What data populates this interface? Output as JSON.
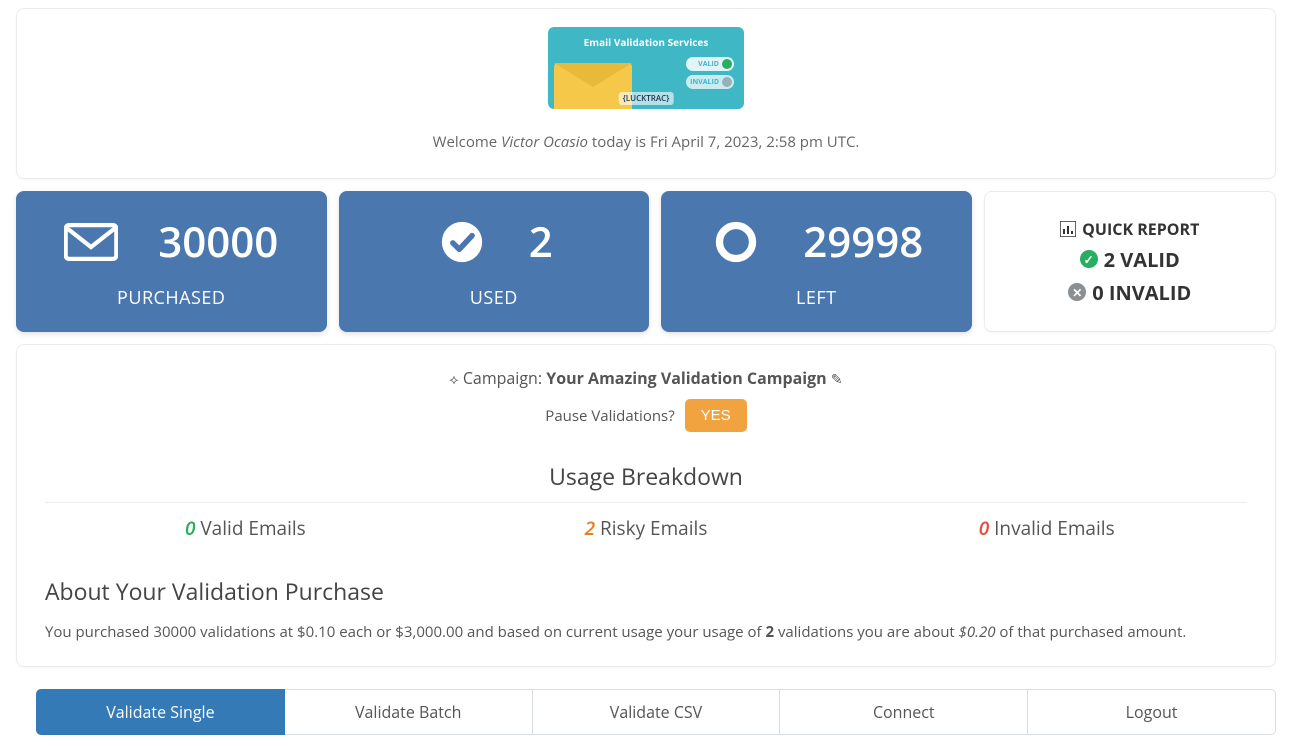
{
  "banner": {
    "title": "Email Validation Services",
    "pill_valid": "VALID",
    "pill_invalid": "INVALID",
    "brand": "{LUCKTRAC}"
  },
  "welcome": {
    "prefix": "Welcome ",
    "user_name": "Victor Ocasio",
    "middle": " today is ",
    "datetime": "Fri April 7, 2023, 2:58 pm UTC."
  },
  "stats": {
    "purchased": {
      "value": "30000",
      "label": "PURCHASED"
    },
    "used": {
      "value": "2",
      "label": "USED"
    },
    "left": {
      "value": "29998",
      "label": "LEFT"
    }
  },
  "quick_report": {
    "title": "QUICK REPORT",
    "valid_line": "2 VALID",
    "invalid_line": "0 INVALID"
  },
  "campaign": {
    "prefix": "Campaign: ",
    "name": "Your Amazing Validation Campaign"
  },
  "pause": {
    "question": "Pause Validations?",
    "button": "YES"
  },
  "usage": {
    "heading": "Usage Breakdown",
    "valid": {
      "count": "0",
      "label": " Valid Emails"
    },
    "risky": {
      "count": "2",
      "label": " Risky Emails"
    },
    "invalid": {
      "count": "0",
      "label": " Invalid Emails"
    }
  },
  "about": {
    "heading": "About Your Validation Purchase",
    "p1": "You purchased 30000 validations at $0.10 each or $3,000.00 and based on current usage your usage of ",
    "p_bold": "2",
    "p2": " validations you are about ",
    "p_em": "$0.20",
    "p3": " of that purchased amount."
  },
  "tabs": {
    "validate_single": "Validate Single",
    "validate_batch": "Validate Batch",
    "validate_csv": "Validate CSV",
    "connect": "Connect",
    "logout": "Logout"
  },
  "colors": {
    "primary_card": "#4977ae",
    "tab_active": "#337ab7",
    "accent_green": "#27ae60",
    "accent_orange": "#e67e22",
    "accent_red": "#e74c3c",
    "warn_button": "#f0a33f"
  }
}
